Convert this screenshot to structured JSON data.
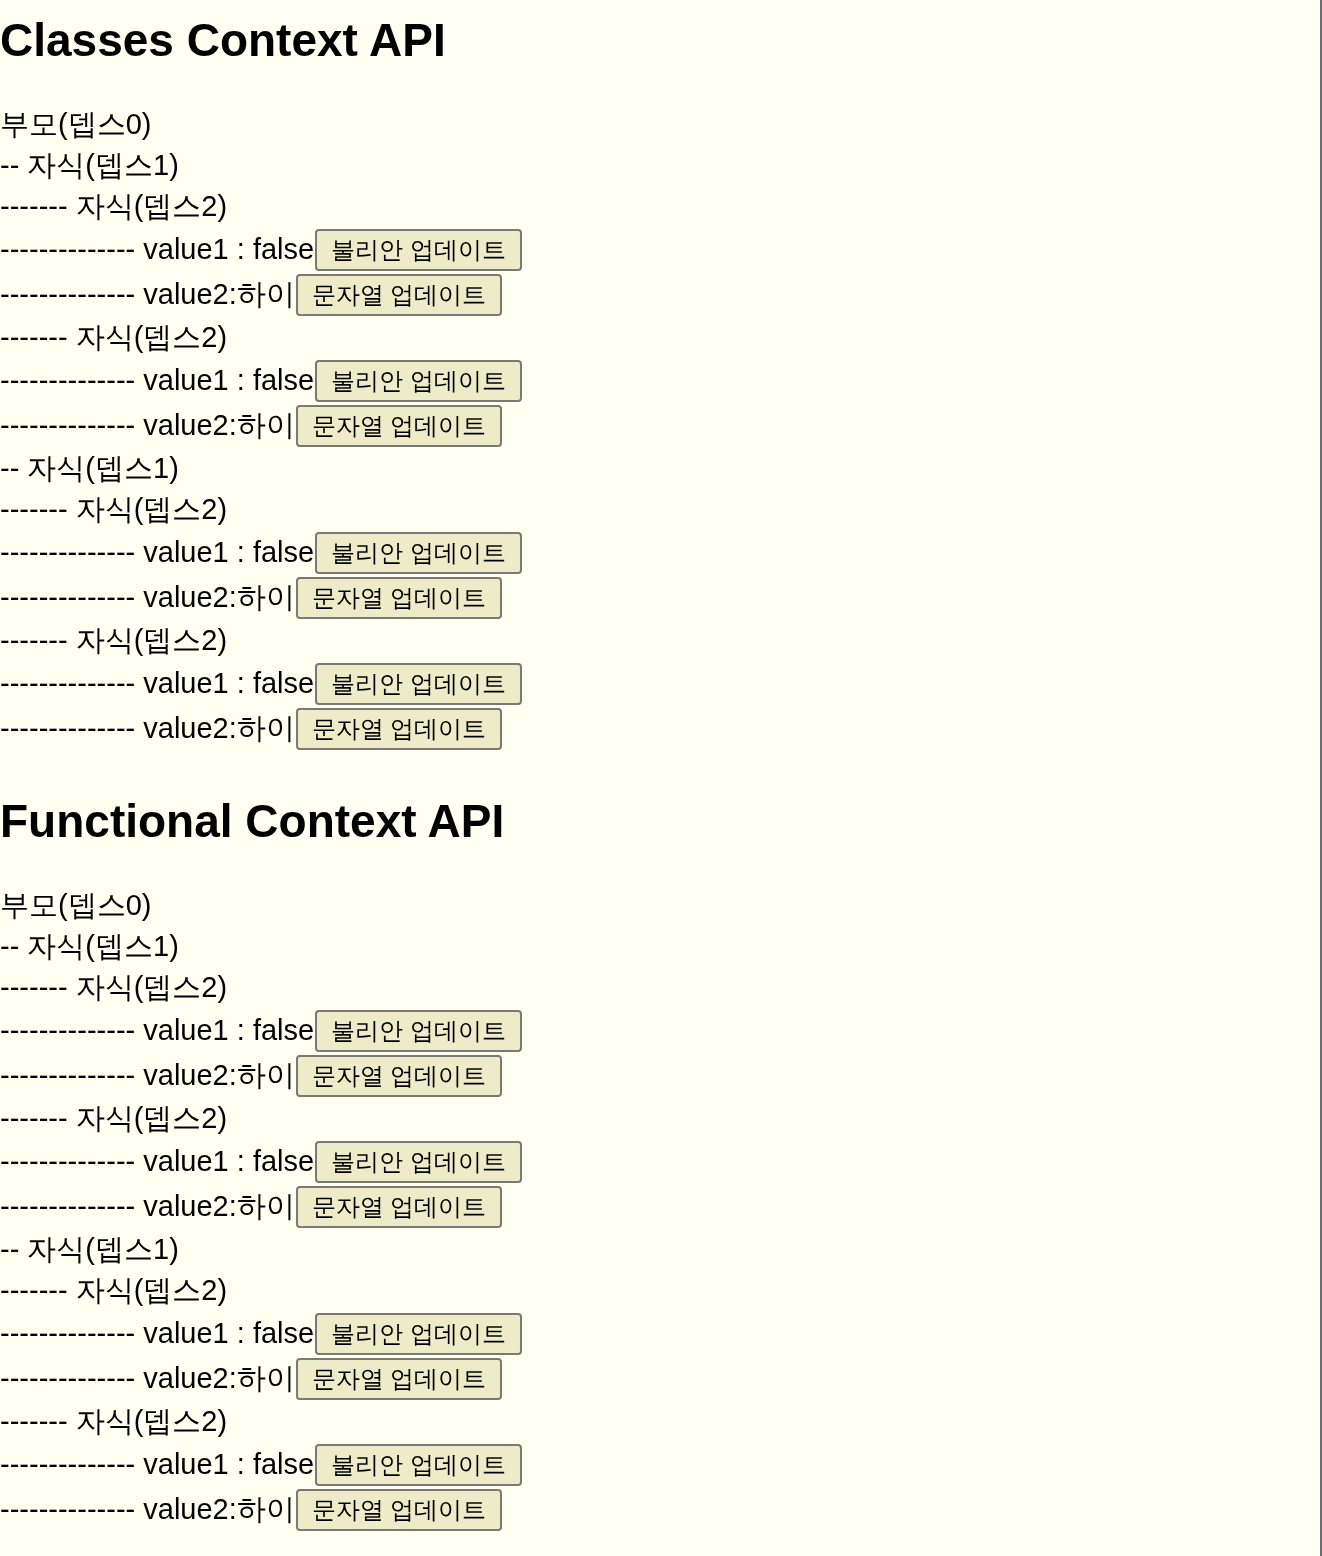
{
  "sections": [
    {
      "title": "Classes Context API",
      "tree": {
        "label": "부모(뎁스0)",
        "children": [
          {
            "label": "-- 자식(뎁스1)",
            "children": [
              {
                "label": "------- 자식(뎁스2)",
                "values": [
                  {
                    "text": "-------------- value1 : false",
                    "button": "불리안 업데이트"
                  },
                  {
                    "text": "-------------- value2:하이",
                    "button": "문자열 업데이트"
                  }
                ]
              },
              {
                "label": "------- 자식(뎁스2)",
                "values": [
                  {
                    "text": "-------------- value1 : false",
                    "button": "불리안 업데이트"
                  },
                  {
                    "text": "-------------- value2:하이",
                    "button": "문자열 업데이트"
                  }
                ]
              }
            ]
          },
          {
            "label": "-- 자식(뎁스1)",
            "children": [
              {
                "label": "------- 자식(뎁스2)",
                "values": [
                  {
                    "text": "-------------- value1 : false",
                    "button": "불리안 업데이트"
                  },
                  {
                    "text": "-------------- value2:하이",
                    "button": "문자열 업데이트"
                  }
                ]
              },
              {
                "label": "------- 자식(뎁스2)",
                "values": [
                  {
                    "text": "-------------- value1 : false",
                    "button": "불리안 업데이트"
                  },
                  {
                    "text": "-------------- value2:하이",
                    "button": "문자열 업데이트"
                  }
                ]
              }
            ]
          }
        ]
      }
    },
    {
      "title": "Functional Context API",
      "tree": {
        "label": "부모(뎁스0)",
        "children": [
          {
            "label": "-- 자식(뎁스1)",
            "children": [
              {
                "label": "------- 자식(뎁스2)",
                "values": [
                  {
                    "text": "-------------- value1 : false",
                    "button": "불리안 업데이트"
                  },
                  {
                    "text": "-------------- value2:하이",
                    "button": "문자열 업데이트"
                  }
                ]
              },
              {
                "label": "------- 자식(뎁스2)",
                "values": [
                  {
                    "text": "-------------- value1 : false",
                    "button": "불리안 업데이트"
                  },
                  {
                    "text": "-------------- value2:하이",
                    "button": "문자열 업데이트"
                  }
                ]
              }
            ]
          },
          {
            "label": "-- 자식(뎁스1)",
            "children": [
              {
                "label": "------- 자식(뎁스2)",
                "values": [
                  {
                    "text": "-------------- value1 : false",
                    "button": "불리안 업데이트"
                  },
                  {
                    "text": "-------------- value2:하이",
                    "button": "문자열 업데이트"
                  }
                ]
              },
              {
                "label": "------- 자식(뎁스2)",
                "values": [
                  {
                    "text": "-------------- value1 : false",
                    "button": "불리안 업데이트"
                  },
                  {
                    "text": "-------------- value2:하이",
                    "button": "문자열 업데이트"
                  }
                ]
              }
            ]
          }
        ]
      }
    }
  ]
}
